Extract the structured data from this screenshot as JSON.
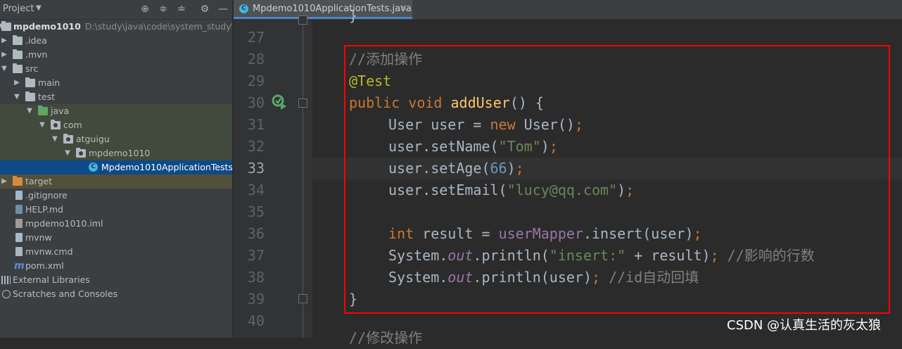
{
  "project_panel": {
    "title": "Project",
    "tree": [
      {
        "label": "mpdemo1010",
        "path": "D:\\study\\java\\code\\system_study\\mpd"
      },
      {
        "label": ".idea"
      },
      {
        "label": ".mvn"
      },
      {
        "label": "src"
      },
      {
        "label": "main"
      },
      {
        "label": "test"
      },
      {
        "label": "java"
      },
      {
        "label": "com"
      },
      {
        "label": "atguigu"
      },
      {
        "label": "mpdemo1010"
      },
      {
        "label": "Mpdemo1010ApplicationTests"
      },
      {
        "label": "target"
      },
      {
        "label": ".gitignore"
      },
      {
        "label": "HELP.md"
      },
      {
        "label": "mpdemo1010.iml"
      },
      {
        "label": "mvnw"
      },
      {
        "label": "mvnw.cmd"
      },
      {
        "label": "pom.xml"
      },
      {
        "label": "External Libraries"
      },
      {
        "label": "Scratches and Consoles"
      }
    ]
  },
  "editor": {
    "tab_label": "Mpdemo1010ApplicationTests.java",
    "line_numbers": [
      "27",
      "28",
      "29",
      "30",
      "31",
      "32",
      "33",
      "34",
      "35",
      "36",
      "37",
      "38",
      "39",
      "40"
    ],
    "current_line": "33",
    "code": {
      "top_brace": "}",
      "l28_comment": "//添加操作",
      "l29_annotation": "@Test",
      "l30_public": "public",
      "l30_void": "void",
      "l30_method": "addUser",
      "l30_rest": "() {",
      "l31_a": "User user = ",
      "l31_new": "new",
      "l31_b": " User()",
      "l31_semi": ";",
      "l32_a": "user.setName(",
      "l32_str": "\"Tom\"",
      "l32_b": ")",
      "l32_semi": ";",
      "l33_a": "user.setAge(",
      "l33_num": "66",
      "l33_b": ")",
      "l33_semi": ";",
      "l34_a": "user.setEmail(",
      "l34_str": "\"lucy@qq.com\"",
      "l34_b": ")",
      "l34_semi": ";",
      "l36_int": "int",
      "l36_a": " result = ",
      "l36_field": "userMapper",
      "l36_b": ".insert(user)",
      "l36_semi": ";",
      "l37_a": "System.",
      "l37_out": "out",
      "l37_b": ".println(",
      "l37_str": "\"insert:\"",
      "l37_c": " + result)",
      "l37_semi": ";",
      "l37_comment": " //影响的行数",
      "l38_a": "System.",
      "l38_out": "out",
      "l38_b": ".println(user)",
      "l38_semi": ";",
      "l38_comment": " //id自动回填",
      "l39": "}",
      "l41_comment": "//修改操作"
    }
  },
  "watermark": "CSDN @认真生活的灰太狼"
}
